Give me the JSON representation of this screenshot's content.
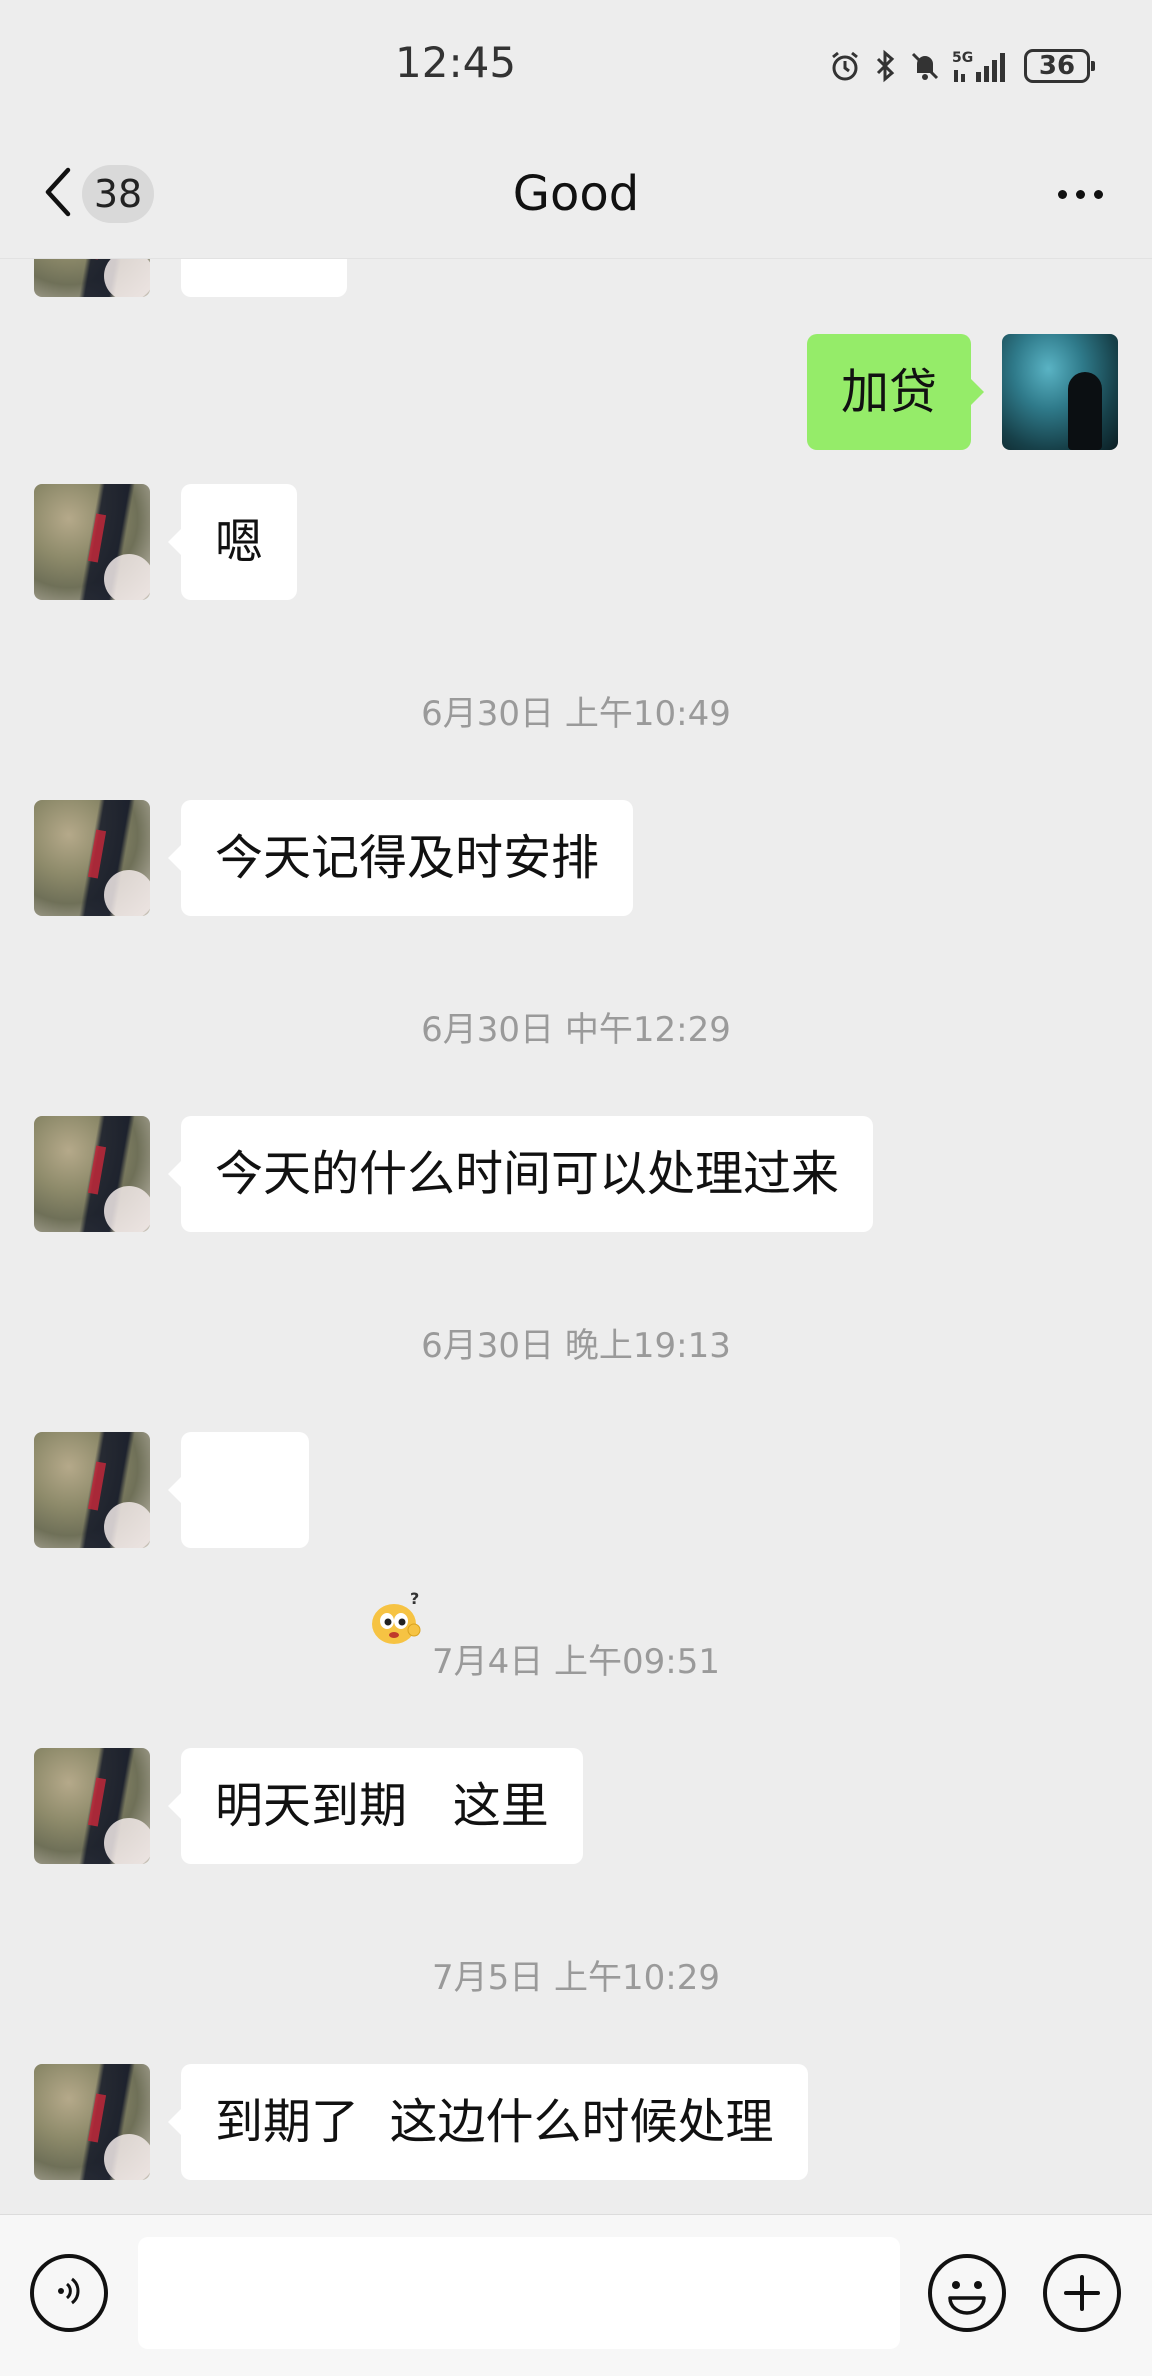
{
  "status_bar": {
    "time": "12:45",
    "network": "5G",
    "battery": "36",
    "icons": [
      "alarm-icon",
      "bluetooth-icon",
      "mute-icon",
      "signal-5g-icon",
      "battery-icon"
    ]
  },
  "header": {
    "unread_count": "38",
    "title": "Good",
    "back_icon": "chevron-left-icon",
    "more_icon": "more-dots-icon"
  },
  "messages": [
    {
      "side": "left",
      "text": "",
      "partial": true
    },
    {
      "side": "right",
      "text": "加贷"
    },
    {
      "side": "left",
      "text": "嗯"
    },
    {
      "timestamp": "6月30日 上午10:49"
    },
    {
      "side": "left",
      "text": "今天记得及时安排"
    },
    {
      "timestamp": "6月30日 中午12:29"
    },
    {
      "side": "left",
      "text": "今天的什么时间可以处理过来"
    },
    {
      "timestamp": "6月30日 晚上19:13"
    },
    {
      "side": "left",
      "sticker": "confused-face-emoji"
    },
    {
      "timestamp": "7月4日 上午09:51"
    },
    {
      "side": "left",
      "text": "明天到期   这里"
    },
    {
      "timestamp": "7月5日 上午10:29"
    },
    {
      "side": "left",
      "text": "到期了  这边什么时候处理"
    }
  ],
  "input_bar": {
    "voice_icon": "voice-icon",
    "emoji_icon": "emoji-icon",
    "plus_icon": "plus-icon",
    "placeholder": ""
  },
  "colors": {
    "background": "#ededed",
    "bubble_left": "#ffffff",
    "bubble_right": "#95ec69",
    "timestamp_text": "#9a9a9a"
  }
}
